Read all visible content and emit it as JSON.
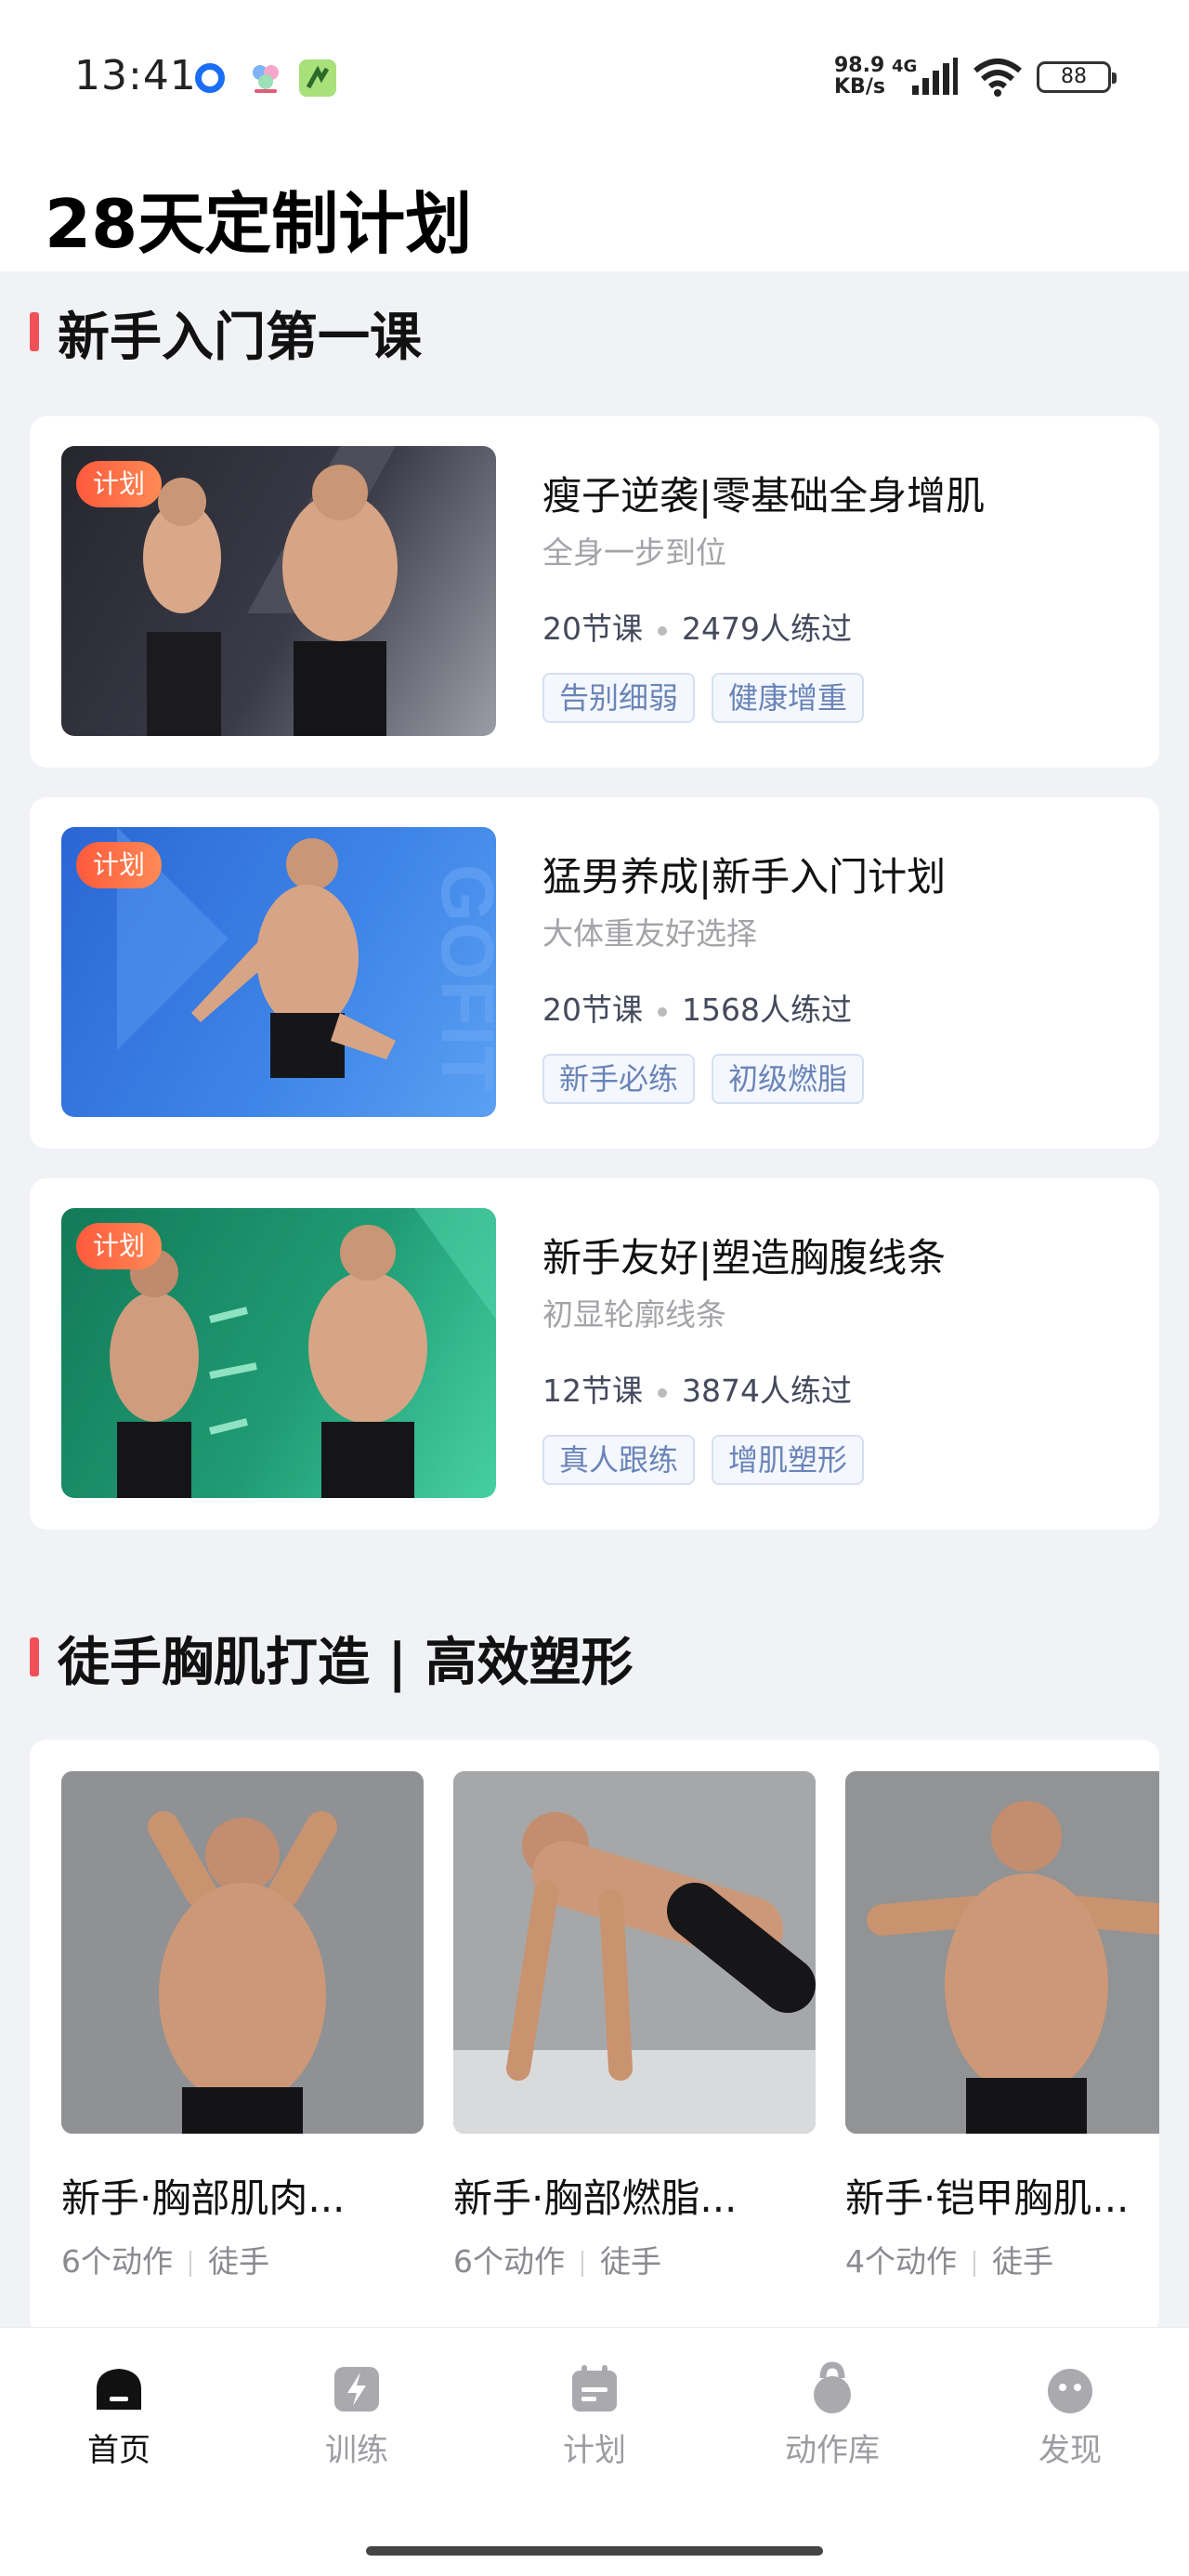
{
  "status_bar": {
    "time": "13:41",
    "net_speed_value": "98.9",
    "net_speed_unit": "KB/s",
    "network": "4G",
    "battery": "88"
  },
  "header": {
    "title": "28天定制计划"
  },
  "section1": {
    "title": "新手入门第一课"
  },
  "plans": [
    {
      "badge": "计划",
      "title": "瘦子逆袭|零基础全身增肌",
      "subtitle": "全身一步到位",
      "lessons": "20节课",
      "trained": "2479人练过",
      "tags": [
        "告别细弱",
        "健康增重"
      ],
      "colors": [
        "#2a2b36",
        "#8e9099"
      ]
    },
    {
      "badge": "计划",
      "title": "猛男养成|新手入门计划",
      "subtitle": "大体重友好选择",
      "lessons": "20节课",
      "trained": "1568人练过",
      "tags": [
        "新手必练",
        "初级燃脂"
      ],
      "colors": [
        "#2f6fd8",
        "#4c93ee"
      ]
    },
    {
      "badge": "计划",
      "title": "新手友好|塑造胸腹线条",
      "subtitle": "初显轮廓线条",
      "lessons": "12节课",
      "trained": "3874人练过",
      "tags": [
        "真人跟练",
        "增肌塑形"
      ],
      "colors": [
        "#1d8c66",
        "#3bc99b"
      ]
    }
  ],
  "section2": {
    "title": "徒手胸肌打造 | 高效塑形"
  },
  "chest_items": [
    {
      "title": "新手·胸部肌肉...",
      "actions": "6个动作",
      "type": "徒手"
    },
    {
      "title": "新手·胸部燃脂...",
      "actions": "6个动作",
      "type": "徒手"
    },
    {
      "title": "新手·铠甲胸肌...",
      "actions": "4个动作",
      "type": "徒手"
    }
  ],
  "tabbar": {
    "home": "首页",
    "train": "训练",
    "plan": "计划",
    "library": "动作库",
    "discover": "发现"
  },
  "accent_color": "#f05058",
  "tag_text_color": "#6a84b8"
}
